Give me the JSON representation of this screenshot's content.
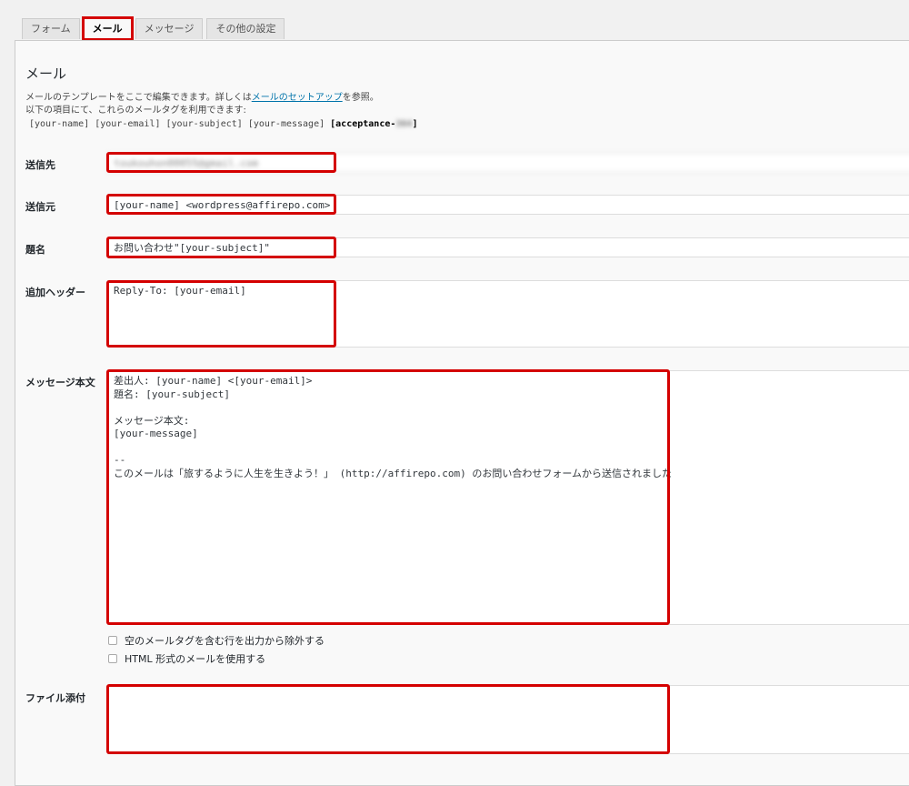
{
  "tabs": [
    {
      "label": "フォーム"
    },
    {
      "label": "メール"
    },
    {
      "label": "メッセージ"
    },
    {
      "label": "その他の設定"
    }
  ],
  "section": {
    "title": "メール",
    "desc_prefix": "メールのテンプレートをここで編集できます。詳しくは",
    "desc_link": "メールのセットアップ",
    "desc_suffix": "を参照。",
    "desc_line2": "以下の項目にて、これらのメールタグを利用できます:",
    "tags_normal": "[your-name] [your-email] [your-subject] [your-message]",
    "tags_bold": "[acceptance-",
    "tags_bold_blurred": "364",
    "tags_bold_end": "]"
  },
  "fields": {
    "to": {
      "label": "送信先",
      "value": "toukouhon00055@gmail.com"
    },
    "from": {
      "label": "送信元",
      "value": "[your-name] <wordpress@affirepo.com>"
    },
    "subject": {
      "label": "題名",
      "value": "お問い合わせ\"[your-subject]\""
    },
    "headers": {
      "label": "追加ヘッダー",
      "value": "Reply-To: [your-email]"
    },
    "body": {
      "label": "メッセージ本文",
      "value": "差出人: [your-name] <[your-email]>\n題名: [your-subject]\n\nメッセージ本文:\n[your-message]\n\n--\nこのメールは「旅するように人生を生きよう！」 (http://affirepo.com) のお問い合わせフォームから送信されました"
    },
    "attachments": {
      "label": "ファイル添付",
      "value": ""
    }
  },
  "checkboxes": {
    "exclude_blank": "空のメールタグを含む行を出力から除外する",
    "use_html": "HTML 形式のメールを使用する"
  },
  "colors": {
    "highlight": "#d40000",
    "link": "#0073aa"
  }
}
